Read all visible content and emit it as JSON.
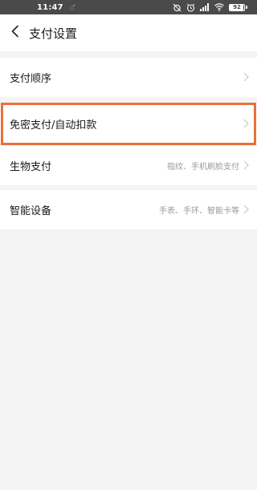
{
  "status_bar": {
    "time": "11:47",
    "extra": "ᯰ",
    "battery_text": "92",
    "battery_level": 0.92,
    "icons": [
      "alarm-off-icon",
      "clock-icon",
      "signal-icon",
      "wifi-icon",
      "battery-icon"
    ]
  },
  "header": {
    "title": "支付设置",
    "back_icon": "chevron-left-icon"
  },
  "settings": {
    "items": [
      {
        "label": "支付顺序",
        "value": ""
      },
      {
        "label": "免密支付/自动扣款",
        "value": ""
      },
      {
        "label": "生物支付",
        "value": "指纹、手机刷脸支付"
      },
      {
        "label": "智能设备",
        "value": "手表、手环、智能卡等"
      }
    ]
  },
  "colors": {
    "background": "#f4f4f4",
    "status_bar": "#4a4a4a",
    "highlight": "#e8703a",
    "secondary_text": "#9a9a9a",
    "chevron": "#c8c8c8"
  }
}
